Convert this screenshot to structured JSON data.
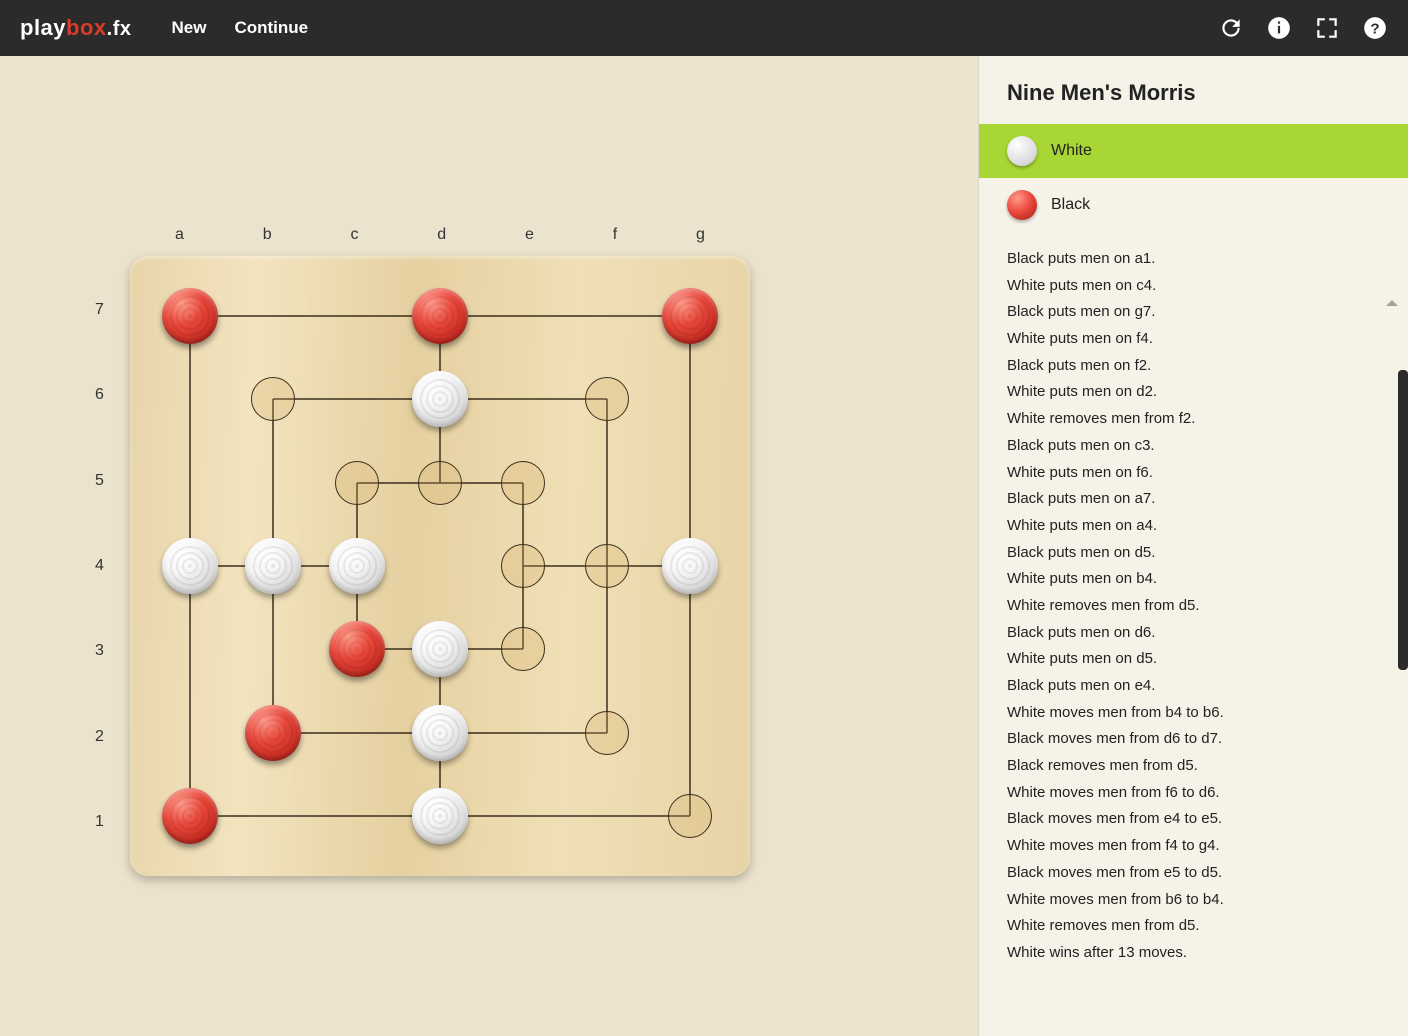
{
  "header": {
    "logo_play": "play",
    "logo_box": "box",
    "logo_fx": ".fx",
    "nav_new": "New",
    "nav_continue": "Continue"
  },
  "panel": {
    "title": "Nine Men's Morris",
    "white_label": "White",
    "black_label": "Black"
  },
  "board": {
    "cols": [
      "a",
      "b",
      "c",
      "d",
      "e",
      "f",
      "g"
    ],
    "rows": [
      "7",
      "6",
      "5",
      "4",
      "3",
      "2",
      "1"
    ],
    "points": [
      {
        "col": "a",
        "row": "7"
      },
      {
        "col": "d",
        "row": "7"
      },
      {
        "col": "g",
        "row": "7"
      },
      {
        "col": "b",
        "row": "6"
      },
      {
        "col": "d",
        "row": "6"
      },
      {
        "col": "f",
        "row": "6"
      },
      {
        "col": "c",
        "row": "5"
      },
      {
        "col": "d",
        "row": "5"
      },
      {
        "col": "e",
        "row": "5"
      },
      {
        "col": "a",
        "row": "4"
      },
      {
        "col": "b",
        "row": "4"
      },
      {
        "col": "c",
        "row": "4"
      },
      {
        "col": "e",
        "row": "4"
      },
      {
        "col": "f",
        "row": "4"
      },
      {
        "col": "g",
        "row": "4"
      },
      {
        "col": "c",
        "row": "3"
      },
      {
        "col": "d",
        "row": "3"
      },
      {
        "col": "e",
        "row": "3"
      },
      {
        "col": "b",
        "row": "2"
      },
      {
        "col": "d",
        "row": "2"
      },
      {
        "col": "f",
        "row": "2"
      },
      {
        "col": "a",
        "row": "1"
      },
      {
        "col": "d",
        "row": "1"
      },
      {
        "col": "g",
        "row": "1"
      }
    ],
    "stones": [
      {
        "col": "a",
        "row": "7",
        "color": "red"
      },
      {
        "col": "d",
        "row": "7",
        "color": "red"
      },
      {
        "col": "g",
        "row": "7",
        "color": "red"
      },
      {
        "col": "d",
        "row": "6",
        "color": "white"
      },
      {
        "col": "a",
        "row": "4",
        "color": "white"
      },
      {
        "col": "b",
        "row": "4",
        "color": "white"
      },
      {
        "col": "c",
        "row": "4",
        "color": "white"
      },
      {
        "col": "g",
        "row": "4",
        "color": "white"
      },
      {
        "col": "c",
        "row": "3",
        "color": "red"
      },
      {
        "col": "d",
        "row": "3",
        "color": "white"
      },
      {
        "col": "b",
        "row": "2",
        "color": "red"
      },
      {
        "col": "d",
        "row": "2",
        "color": "white"
      },
      {
        "col": "a",
        "row": "1",
        "color": "red"
      },
      {
        "col": "d",
        "row": "1",
        "color": "white"
      }
    ]
  },
  "moves": [
    "Black puts men on a1.",
    "White puts men on c4.",
    "Black puts men on g7.",
    "White puts men on f4.",
    "Black puts men on f2.",
    "White puts men on d2.",
    "White removes men from f2.",
    "Black puts men on c3.",
    "White puts men on f6.",
    "Black puts men on a7.",
    "White puts men on a4.",
    "Black puts men on d5.",
    "White puts men on b4.",
    "White removes men from d5.",
    "Black puts men on d6.",
    "White puts men on d5.",
    "Black puts men on e4.",
    "White moves men from b4 to b6.",
    "Black moves men from d6 to d7.",
    "Black removes men from d5.",
    "White moves men from f6 to d6.",
    "Black moves men from e4 to e5.",
    "White moves men from f4 to g4.",
    "Black moves men from e5 to d5.",
    "White moves men from b6 to b4.",
    "White removes men from d5.",
    "White wins after 13 moves."
  ]
}
